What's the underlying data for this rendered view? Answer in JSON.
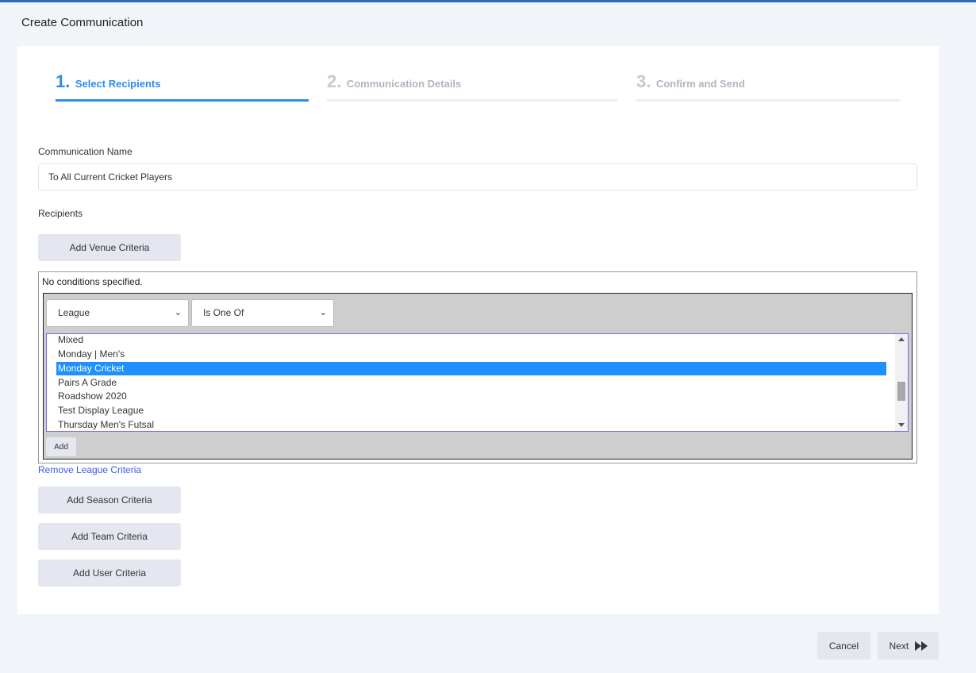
{
  "page": {
    "title": "Create Communication"
  },
  "steps": [
    {
      "num": "1.",
      "label": "Select Recipients"
    },
    {
      "num": "2.",
      "label": "Communication Details"
    },
    {
      "num": "3.",
      "label": "Confirm and Send"
    }
  ],
  "form": {
    "name_label": "Communication Name",
    "name_value": "To All Current Cricket Players",
    "recipients_label": "Recipients",
    "add_venue": "Add Venue Criteria",
    "no_conditions": "No conditions specified.",
    "field_select": "League",
    "operator_select": "Is One Of",
    "list_items": [
      "Mixed",
      "Monday | Men's",
      "Monday Cricket",
      "Pairs A Grade",
      "Roadshow 2020",
      "Test Display League",
      "Thursday Men's Futsal"
    ],
    "selected_item": "Monday Cricket",
    "add_label": "Add",
    "remove_league": "Remove League Criteria",
    "add_season": "Add Season Criteria",
    "add_team": "Add Team Criteria",
    "add_user": "Add User Criteria"
  },
  "footer": {
    "cancel": "Cancel",
    "next": "Next",
    "next_icon": "fast-forward-icon"
  },
  "colors": {
    "accent": "#2d8cf0",
    "topbar": "#2e6bb5",
    "selection": "#1e90ff",
    "link": "#3c5ae0"
  }
}
